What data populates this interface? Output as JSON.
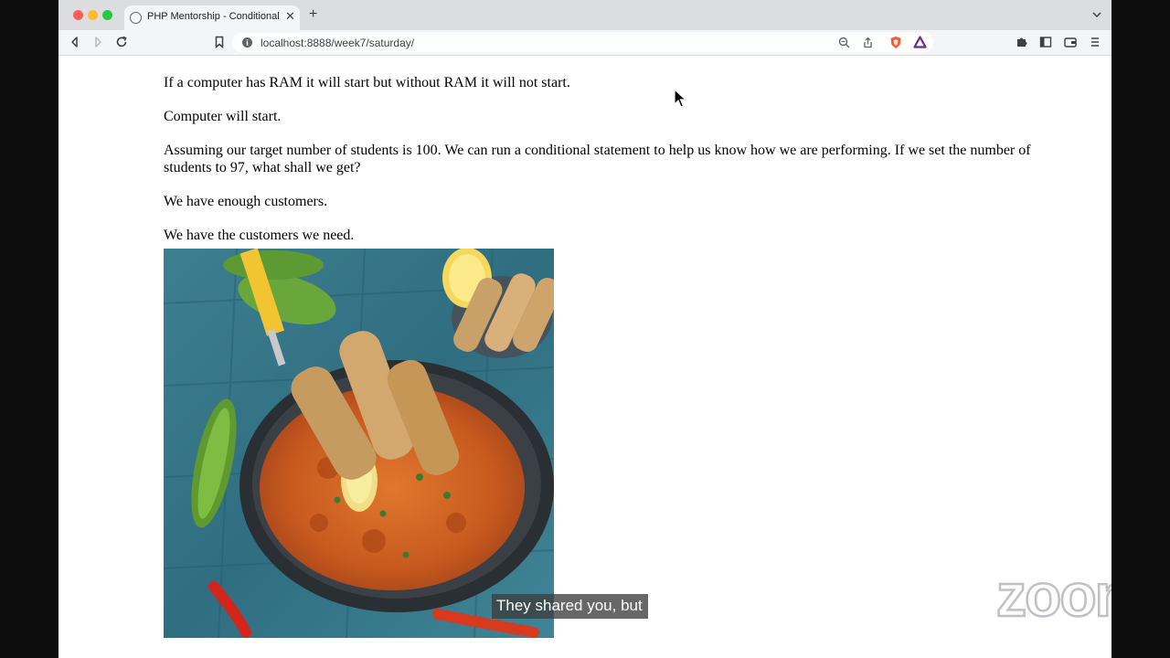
{
  "browser": {
    "tab_title": "PHP Mentorship - Conditional S",
    "url": "localhost:8888/week7/saturday/"
  },
  "page": {
    "paragraphs": [
      "If a computer has RAM it will start but without RAM it will not start.",
      "Computer will start.",
      "Assuming our target number of students is 100. We can run a conditional statement to help us know how we are performing. If we set the number of students to 97, what shall we get?",
      "We have enough customers.",
      "We have the customers we need."
    ]
  },
  "overlay": {
    "caption": "They shared you, but",
    "watermark": "zoom"
  },
  "colors": {
    "traffic_close": "#ff5f57",
    "traffic_minimize": "#febc2e",
    "traffic_maximize": "#28c840",
    "brave_shield": "#fb542b",
    "brave_rewards": "#662d91"
  }
}
